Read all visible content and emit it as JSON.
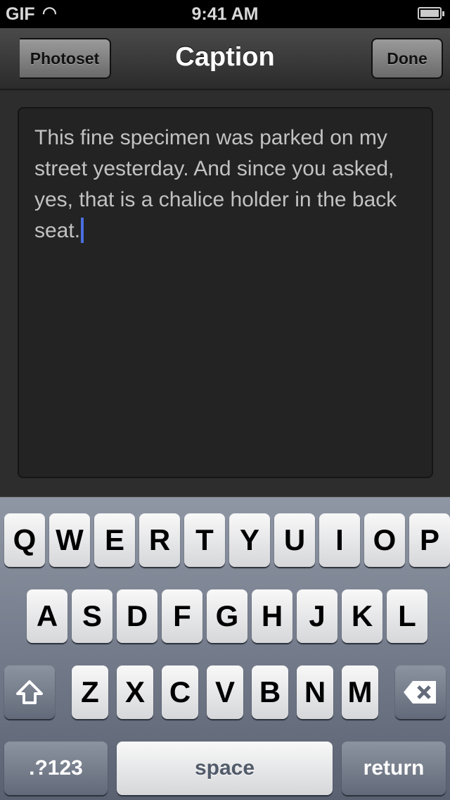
{
  "status_bar": {
    "carrier": "GIF",
    "time": "9:41 AM",
    "wifi_icon": "wifi-icon",
    "battery_icon": "battery-icon"
  },
  "nav": {
    "title": "Caption",
    "back_label": "Photoset",
    "done_label": "Done"
  },
  "caption": {
    "text": "This fine specimen was parked on my street yesterday. And since you asked, yes, that is a chalice holder in the back seat.",
    "cursor_color": "#4a6fe0"
  },
  "keyboard": {
    "rows": [
      [
        "Q",
        "W",
        "E",
        "R",
        "T",
        "Y",
        "U",
        "I",
        "O",
        "P"
      ],
      [
        "A",
        "S",
        "D",
        "F",
        "G",
        "H",
        "J",
        "K",
        "L"
      ],
      [
        "Z",
        "X",
        "C",
        "V",
        "B",
        "N",
        "M"
      ]
    ],
    "shift_icon": "shift-arrow-icon",
    "delete_icon": "backspace-icon",
    "numbers_label": ".?123",
    "space_label": "space",
    "return_label": "return"
  }
}
